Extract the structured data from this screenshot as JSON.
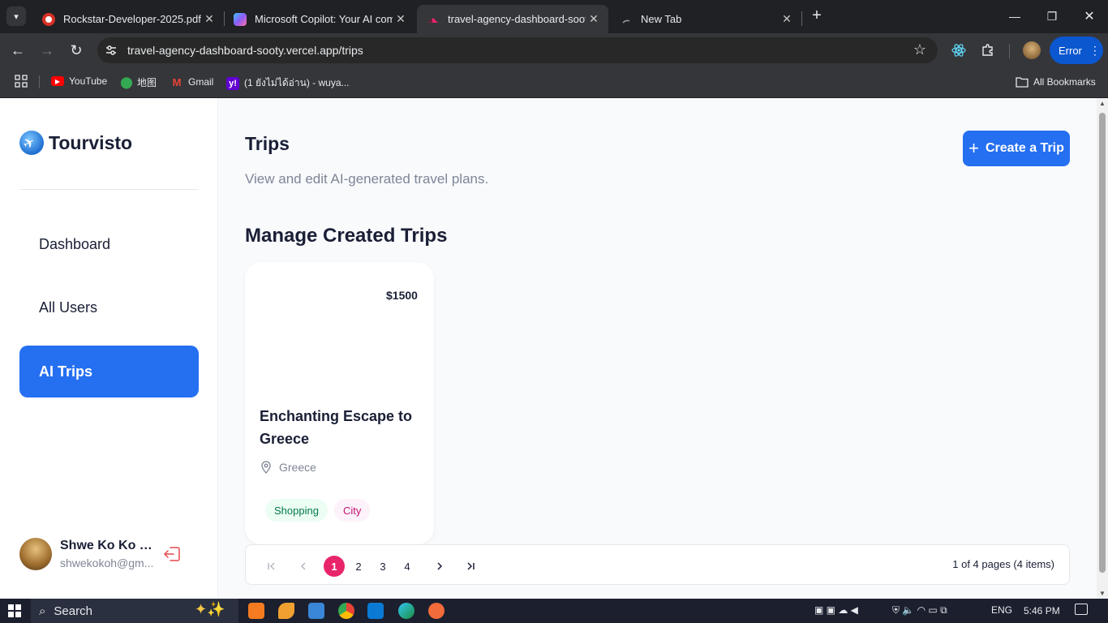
{
  "browser": {
    "tabs": [
      {
        "title": "Rockstar-Developer-2025.pdf",
        "icon": "pdf-icon",
        "color": "#d93025"
      },
      {
        "title": "Microsoft Copilot: Your AI comp",
        "icon": "copilot-icon",
        "color": "#8a5cf6"
      },
      {
        "title": "travel-agency-dashboard-sooty",
        "icon": "vercel-icon",
        "color": "#e8246a",
        "active": true
      },
      {
        "title": "New Tab",
        "icon": "chrome-icon",
        "color": "#9aa0a6"
      }
    ],
    "url": "travel-agency-dashboard-sooty.vercel.app/trips",
    "error_label": "Error",
    "bookmarks": [
      {
        "label": "YouTube",
        "icon": "youtube-icon"
      },
      {
        "label": "地图",
        "icon": "maps-icon"
      },
      {
        "label": "Gmail",
        "icon": "gmail-icon"
      },
      {
        "label": "(1 ยังไม่ได้อ่าน) - wuya...",
        "icon": "yahoo-icon"
      }
    ],
    "all_bookmarks": "All Bookmarks"
  },
  "sidebar": {
    "logo_text": "Tourvisto",
    "nav": [
      {
        "label": "Dashboard"
      },
      {
        "label": "All Users"
      },
      {
        "label": "AI Trips",
        "active": true
      }
    ],
    "user": {
      "name": "Shwe Ko Ko H...",
      "email": "shwekokoh@gm..."
    }
  },
  "main": {
    "title": "Trips",
    "subtitle": "View and edit AI-generated travel plans.",
    "create_button": "Create a Trip",
    "section_title": "Manage Created Trips",
    "trips": [
      {
        "price": "$1500",
        "name": "Enchanting Escape to Greece",
        "location": "Greece",
        "tags": [
          "Shopping",
          "City"
        ]
      }
    ],
    "pagination": {
      "pages": [
        "1",
        "2",
        "3",
        "4"
      ],
      "current": 1,
      "info": "1 of 4 pages (4 items)"
    }
  },
  "taskbar": {
    "search_placeholder": "Search",
    "language": "ENG",
    "time": "5:46 PM"
  },
  "colors": {
    "accent": "#256ff1",
    "page_active": "#e8246a",
    "tag_shopping_bg": "#ecfdf3",
    "tag_city_bg": "#fdf2fa"
  }
}
